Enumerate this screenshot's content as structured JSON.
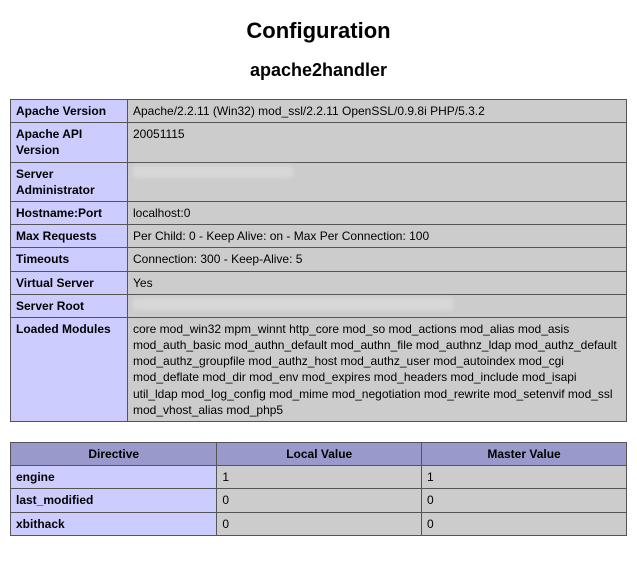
{
  "title": "Configuration",
  "section": "apache2handler",
  "info": [
    {
      "key": "Apache Version",
      "val": "Apache/2.2.11 (Win32) mod_ssl/2.2.11 OpenSSL/0.9.8i PHP/5.3.2"
    },
    {
      "key": "Apache API Version",
      "val": "20051115"
    },
    {
      "key": "Server Administrator",
      "val": "",
      "redacted": true
    },
    {
      "key": "Hostname:Port",
      "val": "localhost:0"
    },
    {
      "key": "Max Requests",
      "val": "Per Child: 0 - Keep Alive: on - Max Per Connection: 100"
    },
    {
      "key": "Timeouts",
      "val": "Connection: 300 - Keep-Alive: 5"
    },
    {
      "key": "Virtual Server",
      "val": "Yes"
    },
    {
      "key": "Server Root",
      "val": "",
      "redacted": true
    },
    {
      "key": "Loaded Modules",
      "val": "core mod_win32 mpm_winnt http_core mod_so mod_actions mod_alias mod_asis mod_auth_basic mod_authn_default mod_authn_file mod_authnz_ldap mod_authz_default mod_authz_groupfile mod_authz_host mod_authz_user mod_autoindex mod_cgi mod_deflate mod_dir mod_env mod_expires mod_headers mod_include mod_isapi util_ldap mod_log_config mod_mime mod_negotiation mod_rewrite mod_setenvif mod_ssl mod_vhost_alias mod_php5"
    }
  ],
  "dir_headers": {
    "directive": "Directive",
    "local": "Local Value",
    "master": "Master Value"
  },
  "directives": [
    {
      "name": "engine",
      "local": "1",
      "master": "1"
    },
    {
      "name": "last_modified",
      "local": "0",
      "master": "0"
    },
    {
      "name": "xbithack",
      "local": "0",
      "master": "0"
    }
  ]
}
